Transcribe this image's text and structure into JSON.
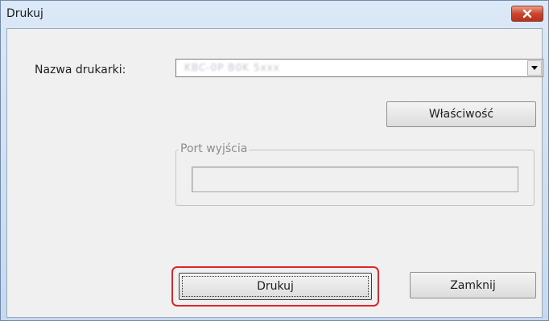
{
  "window": {
    "title": "Drukuj",
    "close_icon": "close-icon",
    "accent_close": "#c9452f"
  },
  "printer": {
    "label": "Nazwa drukarki:",
    "selected_value": "KBC-0P B0K 5xxx",
    "dropdown_icon": "chevron-down-icon"
  },
  "properties_button": {
    "label": "Właściwość"
  },
  "output_port": {
    "legend": "Port wyjścia",
    "value": ""
  },
  "buttons": {
    "print_label": "Drukuj",
    "close_label": "Zamknij"
  },
  "highlight_color": "#e0242a"
}
